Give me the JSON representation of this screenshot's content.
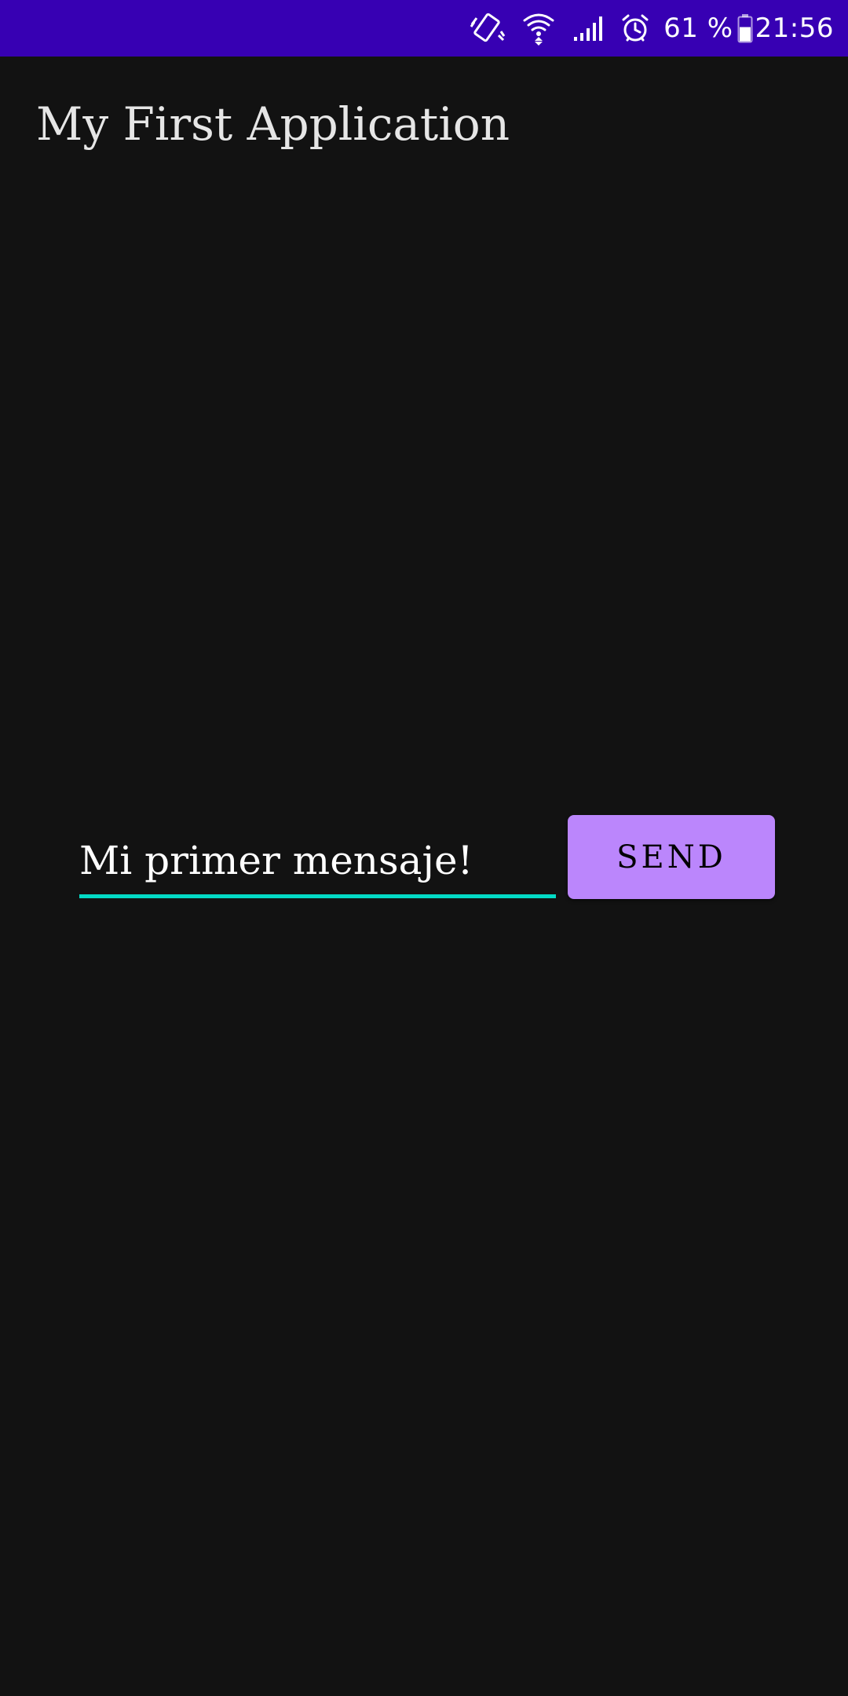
{
  "status_bar": {
    "battery_percent": "61 %",
    "time": "21:56",
    "icons": [
      "vibrate-icon",
      "wifi-icon",
      "signal-icon",
      "alarm-icon",
      "battery-icon"
    ],
    "background_color": "#3700b3",
    "battery_level": 0.61
  },
  "app_bar": {
    "title": "My First Application"
  },
  "composer": {
    "input_value": "Mi primer mensaje!",
    "send_label": "SEND",
    "accent_color": "#03dac5",
    "button_color": "#bb86fc"
  },
  "theme": {
    "background": "#121212"
  }
}
